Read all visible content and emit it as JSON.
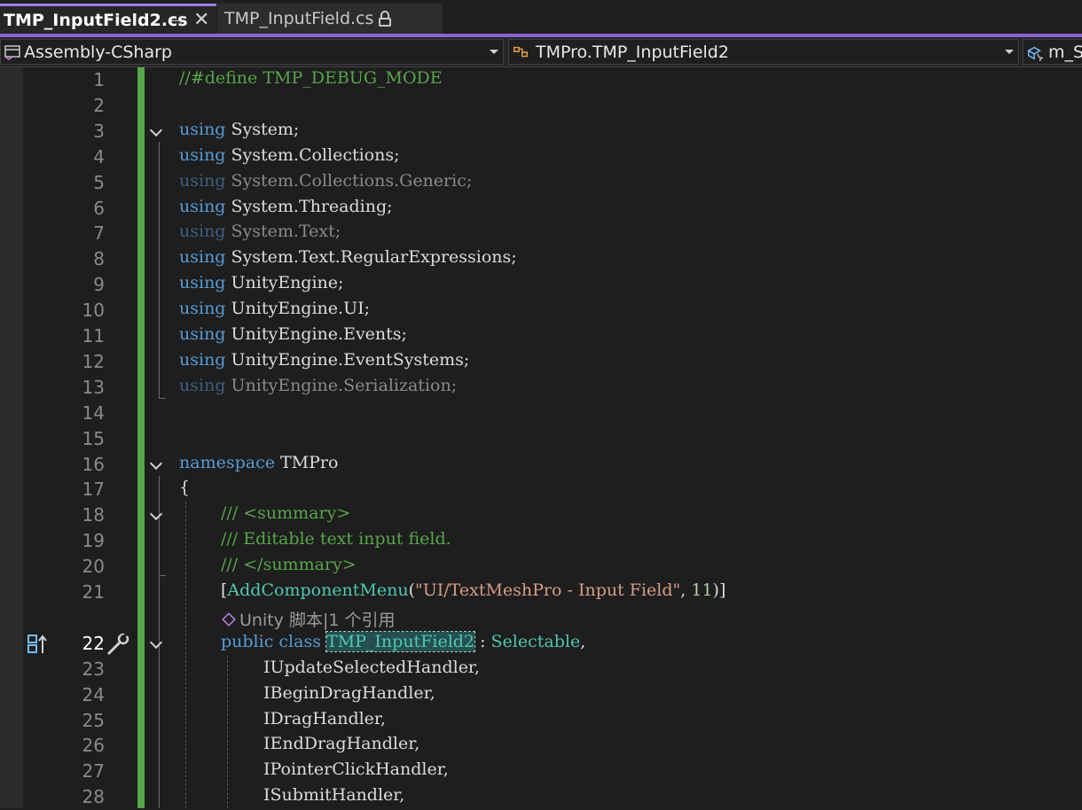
{
  "tabs": [
    {
      "label": "TMP_InputField2.cs",
      "active": true,
      "pin_glyph": "⊣",
      "close_glyph": "✕"
    },
    {
      "label": "TMP_InputField.cs",
      "active": false,
      "icon": "lock-icon"
    }
  ],
  "navbar": {
    "project": "Assembly-CSharp",
    "type": "TMPro.TMP_InputField2",
    "member": "m_Sc"
  },
  "colors": {
    "accent": "#8a63d2",
    "keyword": "#569cd6",
    "type": "#4ec9b0",
    "comment": "#57a64a",
    "string": "#d69d85",
    "number": "#b5cea8",
    "text": "#dcdcdc",
    "faded_keyword": "#3e5f82",
    "faded_text": "#8a8a8a"
  },
  "editor": {
    "current_line": 22,
    "codelens": {
      "line_after": 21,
      "text": "Unity 脚本|1 个引用"
    },
    "lines": [
      {
        "n": 1,
        "tokens": [
          [
            "//#define TMP_DEBUG_MODE",
            "comment"
          ]
        ]
      },
      {
        "n": 2,
        "tokens": []
      },
      {
        "n": 3,
        "fold": true,
        "tokens": [
          [
            "using",
            "keyword"
          ],
          [
            " System;",
            "text"
          ]
        ]
      },
      {
        "n": 4,
        "tokens": [
          [
            "using",
            "keyword"
          ],
          [
            " System.Collections;",
            "text"
          ]
        ]
      },
      {
        "n": 5,
        "tokens": [
          [
            "using",
            "faded_keyword"
          ],
          [
            " System.Collections.Generic;",
            "faded_text"
          ]
        ]
      },
      {
        "n": 6,
        "tokens": [
          [
            "using",
            "keyword"
          ],
          [
            " System.Threading;",
            "text"
          ]
        ]
      },
      {
        "n": 7,
        "tokens": [
          [
            "using",
            "faded_keyword"
          ],
          [
            " System.Text;",
            "faded_text"
          ]
        ]
      },
      {
        "n": 8,
        "tokens": [
          [
            "using",
            "keyword"
          ],
          [
            " System.Text.RegularExpressions;",
            "text"
          ]
        ]
      },
      {
        "n": 9,
        "tokens": [
          [
            "using",
            "keyword"
          ],
          [
            " UnityEngine;",
            "text"
          ]
        ]
      },
      {
        "n": 10,
        "tokens": [
          [
            "using",
            "keyword"
          ],
          [
            " UnityEngine.UI;",
            "text"
          ]
        ]
      },
      {
        "n": 11,
        "tokens": [
          [
            "using",
            "keyword"
          ],
          [
            " UnityEngine.Events;",
            "text"
          ]
        ]
      },
      {
        "n": 12,
        "tokens": [
          [
            "using",
            "keyword"
          ],
          [
            " UnityEngine.EventSystems;",
            "text"
          ]
        ]
      },
      {
        "n": 13,
        "tokens": [
          [
            "using",
            "faded_keyword"
          ],
          [
            " UnityEngine.Serialization;",
            "faded_text"
          ]
        ]
      },
      {
        "n": 14,
        "tokens": []
      },
      {
        "n": 15,
        "tokens": []
      },
      {
        "n": 16,
        "fold": true,
        "tokens": [
          [
            "namespace",
            "keyword"
          ],
          [
            " TMPro",
            "text"
          ]
        ]
      },
      {
        "n": 17,
        "tokens": [
          [
            "{",
            "text"
          ]
        ]
      },
      {
        "n": 18,
        "fold": true,
        "indent": 1,
        "tokens": [
          [
            "/// <summary>",
            "comment"
          ]
        ]
      },
      {
        "n": 19,
        "indent": 1,
        "tokens": [
          [
            "/// Editable text input field.",
            "comment"
          ]
        ]
      },
      {
        "n": 20,
        "indent": 1,
        "tokens": [
          [
            "/// </summary>",
            "comment"
          ]
        ]
      },
      {
        "n": 21,
        "indent": 1,
        "tokens": [
          [
            "[",
            "text"
          ],
          [
            "AddComponentMenu",
            "type"
          ],
          [
            "(",
            "text"
          ],
          [
            "\"UI/TextMeshPro - Input Field\"",
            "string"
          ],
          [
            ", ",
            "text"
          ],
          [
            "11",
            "number"
          ],
          [
            ")]",
            "text"
          ]
        ]
      },
      {
        "n": 22,
        "fold": true,
        "indent": 1,
        "tokens": [
          [
            "public",
            "keyword"
          ],
          [
            " ",
            "text"
          ],
          [
            "class",
            "keyword"
          ],
          [
            " ",
            "text"
          ],
          [
            "TMP_InputField2",
            "type_hl"
          ],
          [
            " : ",
            "text"
          ],
          [
            "Selectable",
            "type"
          ],
          [
            ",",
            "text"
          ]
        ]
      },
      {
        "n": 23,
        "indent": 2,
        "tokens": [
          [
            "IUpdateSelectedHandler,",
            "text"
          ]
        ]
      },
      {
        "n": 24,
        "indent": 2,
        "tokens": [
          [
            "IBeginDragHandler,",
            "text"
          ]
        ]
      },
      {
        "n": 25,
        "indent": 2,
        "tokens": [
          [
            "IDragHandler,",
            "text"
          ]
        ]
      },
      {
        "n": 26,
        "indent": 2,
        "tokens": [
          [
            "IEndDragHandler,",
            "text"
          ]
        ]
      },
      {
        "n": 27,
        "indent": 2,
        "tokens": [
          [
            "IPointerClickHandler,",
            "text"
          ]
        ]
      },
      {
        "n": 28,
        "indent": 2,
        "tokens": [
          [
            "ISubmitHandler,",
            "text"
          ]
        ]
      }
    ]
  }
}
